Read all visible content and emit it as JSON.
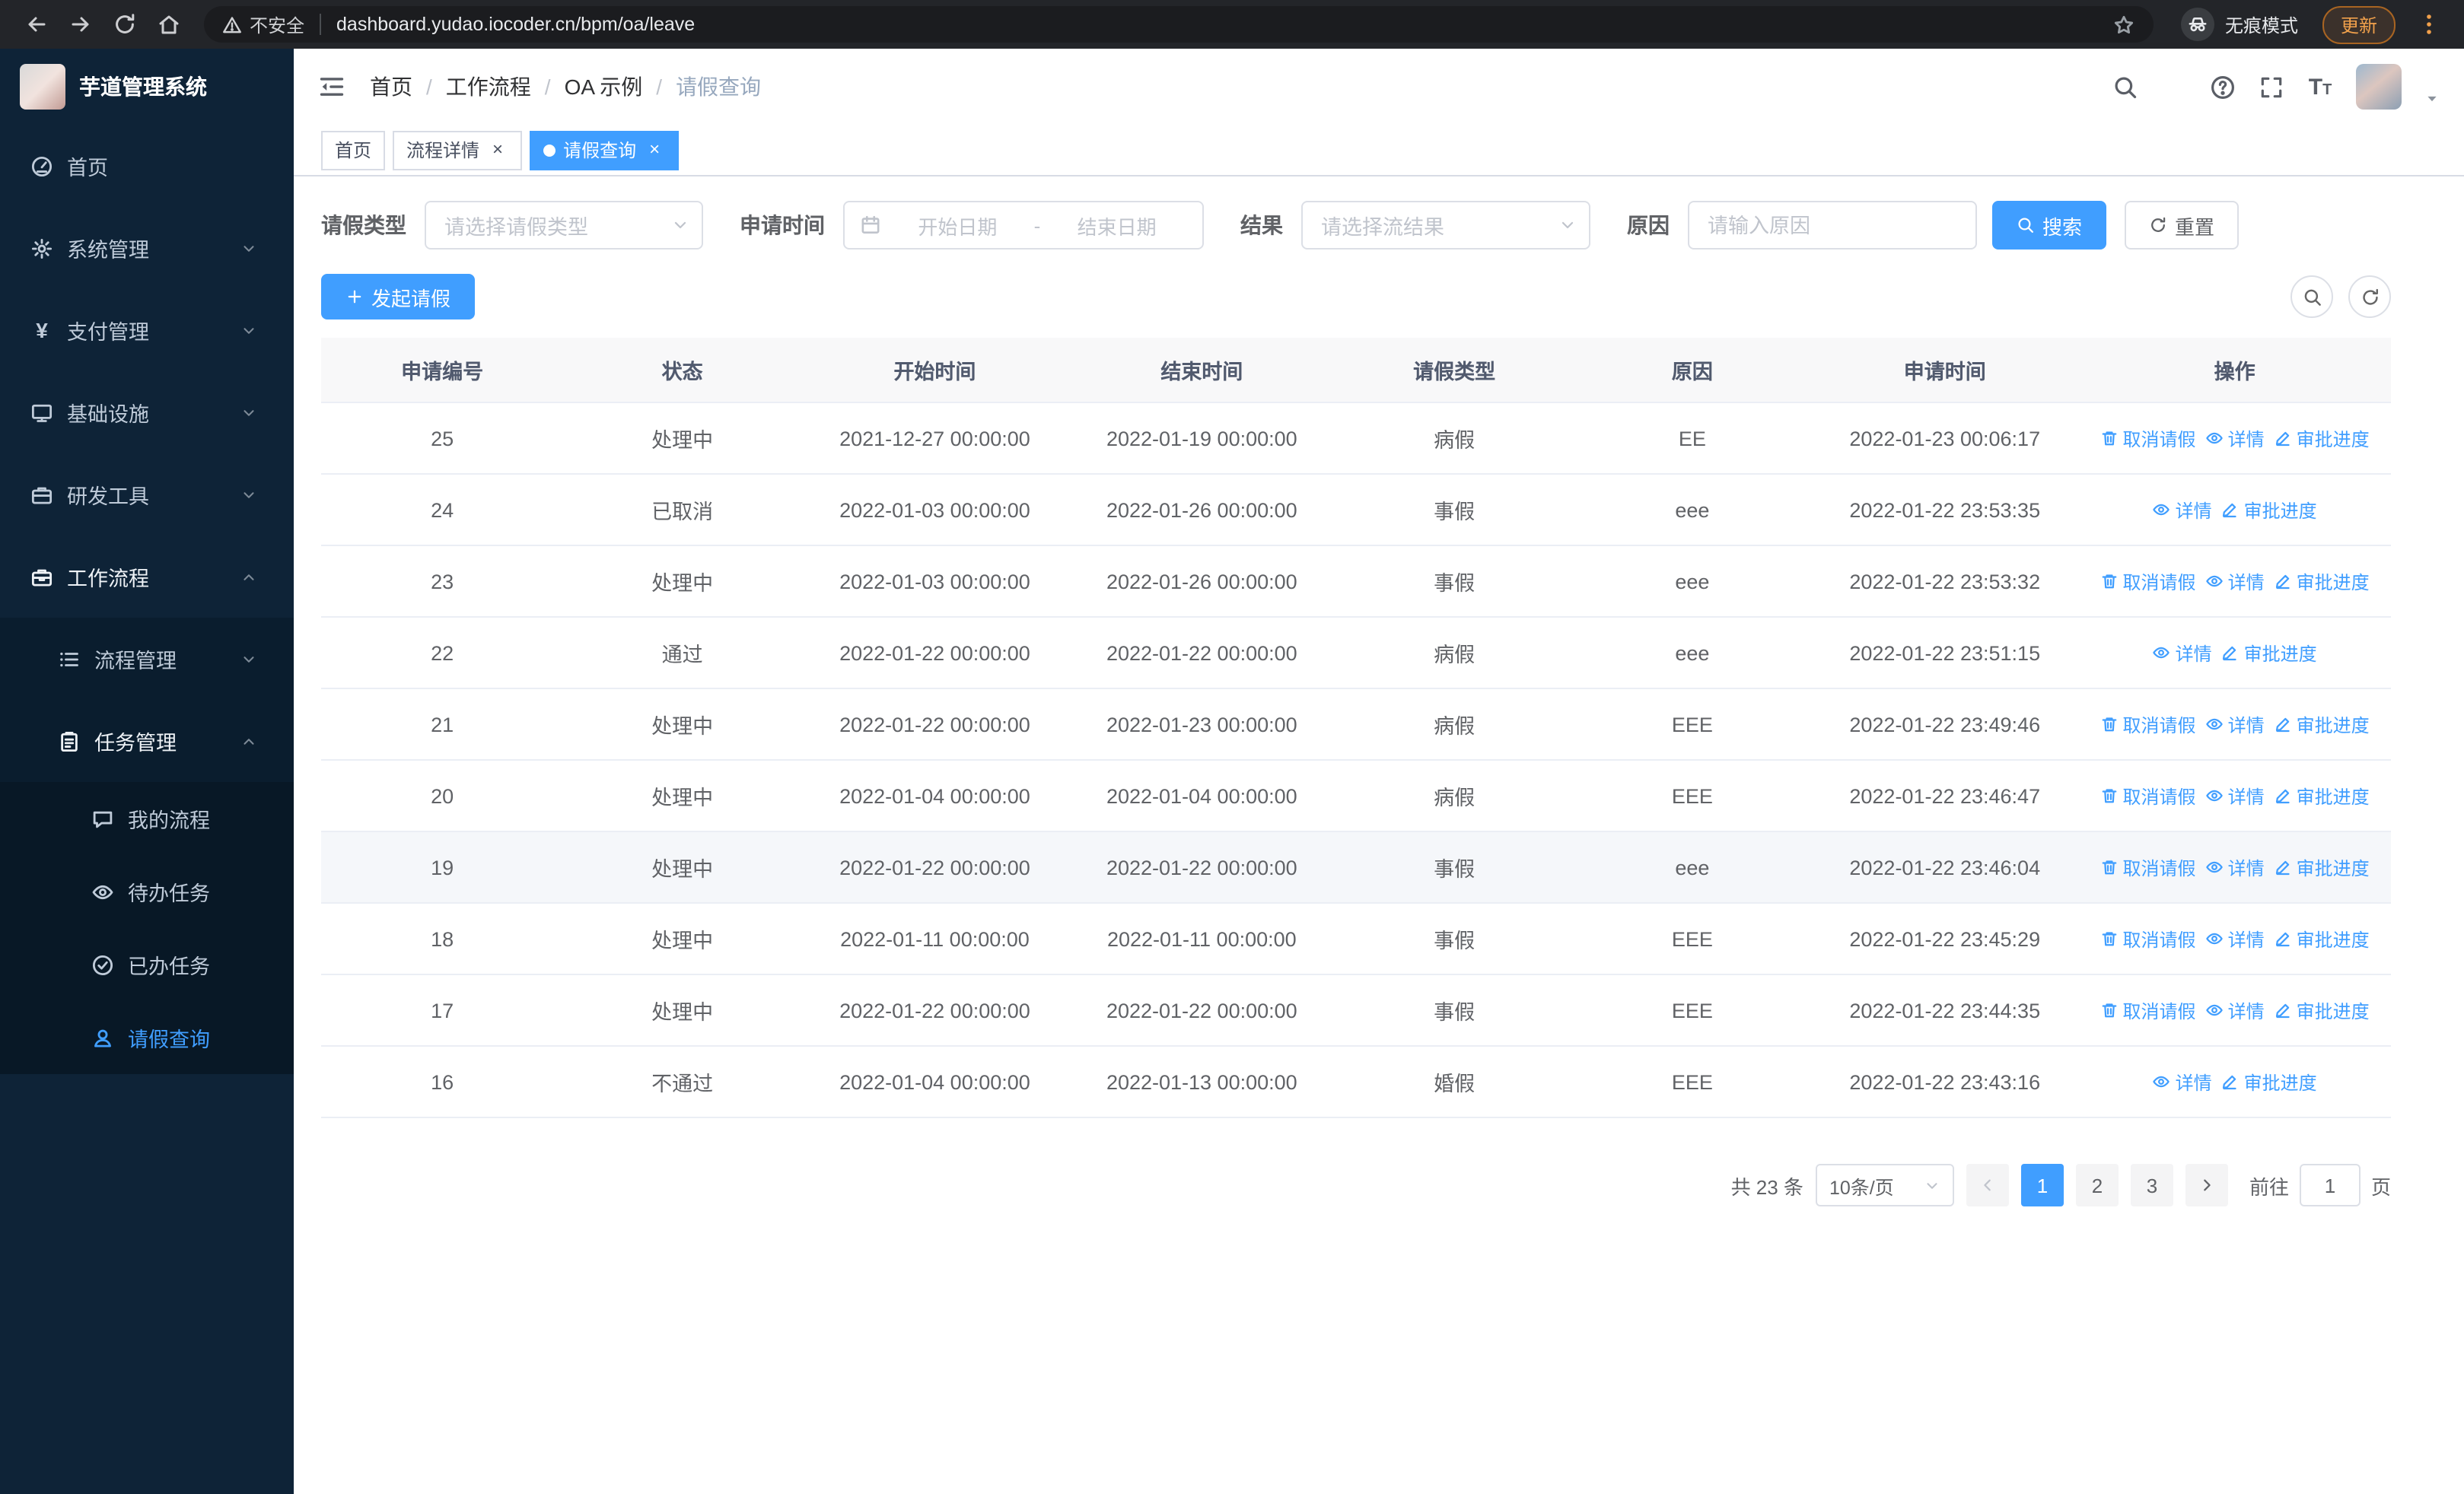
{
  "browser": {
    "nav_icons": [
      "back-arrow-icon",
      "forward-arrow-icon",
      "refresh-icon",
      "home-icon"
    ],
    "security_icon": "warning-icon",
    "security_label": "不安全",
    "url": "dashboard.yudao.iocoder.cn/bpm/oa/leave",
    "bookmark_icon": "star-icon",
    "incognito_icon": "incognito-icon",
    "incognito_label": "无痕模式",
    "update_label": "更新",
    "menu_icon": "dots-vertical-icon"
  },
  "sidebar": {
    "logo_title": "芋道管理系统",
    "items": [
      {
        "key": "home",
        "label": "首页",
        "icon": "dashboard-icon",
        "level": 0
      },
      {
        "key": "system",
        "label": "系统管理",
        "icon": "gear-icon",
        "level": 0,
        "arrow": "down"
      },
      {
        "key": "payment",
        "label": "支付管理",
        "icon": "yen-icon",
        "level": 0,
        "arrow": "down"
      },
      {
        "key": "infrastructure",
        "label": "基础设施",
        "icon": "monitor-icon",
        "level": 0,
        "arrow": "down"
      },
      {
        "key": "devtools",
        "label": "研发工具",
        "icon": "toolbox-icon",
        "level": 0,
        "arrow": "down"
      },
      {
        "key": "workflow",
        "label": "工作流程",
        "icon": "briefcase-icon",
        "level": 0,
        "arrow": "up",
        "open": true
      },
      {
        "key": "process-management",
        "label": "流程管理",
        "icon": "list-icon",
        "level": 1,
        "arrow": "down"
      },
      {
        "key": "task-management",
        "label": "任务管理",
        "icon": "clipboard-icon",
        "level": 1,
        "arrow": "up",
        "open": true
      },
      {
        "key": "my-process",
        "label": "我的流程",
        "icon": "chat-icon",
        "level": 2
      },
      {
        "key": "todo-task",
        "label": "待办任务",
        "icon": "eye-icon",
        "level": 2
      },
      {
        "key": "done-task",
        "label": "已办任务",
        "icon": "check-circle-icon",
        "level": 2
      },
      {
        "key": "leave-query",
        "label": "请假查询",
        "icon": "user-icon",
        "level": 2,
        "active": true
      }
    ]
  },
  "header": {
    "toggle_icon": "fold-icon",
    "breadcrumb": [
      "首页",
      "工作流程",
      "OA 示例",
      "请假查询"
    ],
    "right_icons": [
      "search-icon",
      "github-icon",
      "question-icon",
      "fullscreen-icon",
      "font-size-icon"
    ],
    "avatar_caret_icon": "caret-down-icon"
  },
  "tabs": [
    {
      "key": "home",
      "label": "首页",
      "closable": false,
      "active": false
    },
    {
      "key": "process-detail",
      "label": "流程详情",
      "closable": true,
      "active": false
    },
    {
      "key": "leave-query",
      "label": "请假查询",
      "closable": true,
      "active": true
    }
  ],
  "filters": {
    "leave_type_label": "请假类型",
    "leave_type_placeholder": "请选择请假类型",
    "select_chevron_icon": "chevron-down-icon",
    "apply_time_label": "申请时间",
    "calendar_icon": "calendar-icon",
    "start_date_placeholder": "开始日期",
    "range_separator": "-",
    "end_date_placeholder": "结束日期",
    "result_label": "结果",
    "result_placeholder": "请选择流结果",
    "reason_label": "原因",
    "reason_placeholder": "请输入原因",
    "search_button": {
      "label": "搜索",
      "icon": "search-icon"
    },
    "reset_button": {
      "label": "重置",
      "icon": "refresh-icon"
    }
  },
  "toolbar": {
    "create_button": {
      "label": "发起请假",
      "icon": "plus-icon"
    },
    "tool_icons": [
      "search-icon",
      "refresh-icon"
    ]
  },
  "table": {
    "columns": [
      "申请编号",
      "状态",
      "开始时间",
      "结束时间",
      "请假类型",
      "原因",
      "申请时间",
      "操作"
    ],
    "action_labels": {
      "cancel": "取消请假",
      "detail": "详情",
      "progress": "审批进度"
    },
    "action_icons": {
      "cancel": "delete-icon",
      "detail": "eye-icon",
      "progress": "edit-icon"
    },
    "rows": [
      {
        "id": "25",
        "status": "处理中",
        "start_time": "2021-12-27 00:00:00",
        "end_time": "2022-01-19 00:00:00",
        "leave_type": "病假",
        "reason": "EE",
        "apply_time": "2022-01-23 00:06:17",
        "actions": [
          "cancel",
          "detail",
          "progress"
        ],
        "hover": false
      },
      {
        "id": "24",
        "status": "已取消",
        "start_time": "2022-01-03 00:00:00",
        "end_time": "2022-01-26 00:00:00",
        "leave_type": "事假",
        "reason": "eee",
        "apply_time": "2022-01-22 23:53:35",
        "actions": [
          "detail",
          "progress"
        ],
        "hover": false
      },
      {
        "id": "23",
        "status": "处理中",
        "start_time": "2022-01-03 00:00:00",
        "end_time": "2022-01-26 00:00:00",
        "leave_type": "事假",
        "reason": "eee",
        "apply_time": "2022-01-22 23:53:32",
        "actions": [
          "cancel",
          "detail",
          "progress"
        ],
        "hover": false
      },
      {
        "id": "22",
        "status": "通过",
        "start_time": "2022-01-22 00:00:00",
        "end_time": "2022-01-22 00:00:00",
        "leave_type": "病假",
        "reason": "eee",
        "apply_time": "2022-01-22 23:51:15",
        "actions": [
          "detail",
          "progress"
        ],
        "hover": false
      },
      {
        "id": "21",
        "status": "处理中",
        "start_time": "2022-01-22 00:00:00",
        "end_time": "2022-01-23 00:00:00",
        "leave_type": "病假",
        "reason": "EEE",
        "apply_time": "2022-01-22 23:49:46",
        "actions": [
          "cancel",
          "detail",
          "progress"
        ],
        "hover": false
      },
      {
        "id": "20",
        "status": "处理中",
        "start_time": "2022-01-04 00:00:00",
        "end_time": "2022-01-04 00:00:00",
        "leave_type": "病假",
        "reason": "EEE",
        "apply_time": "2022-01-22 23:46:47",
        "actions": [
          "cancel",
          "detail",
          "progress"
        ],
        "hover": false
      },
      {
        "id": "19",
        "status": "处理中",
        "start_time": "2022-01-22 00:00:00",
        "end_time": "2022-01-22 00:00:00",
        "leave_type": "事假",
        "reason": "eee",
        "apply_time": "2022-01-22 23:46:04",
        "actions": [
          "cancel",
          "detail",
          "progress"
        ],
        "hover": true
      },
      {
        "id": "18",
        "status": "处理中",
        "start_time": "2022-01-11 00:00:00",
        "end_time": "2022-01-11 00:00:00",
        "leave_type": "事假",
        "reason": "EEE",
        "apply_time": "2022-01-22 23:45:29",
        "actions": [
          "cancel",
          "detail",
          "progress"
        ],
        "hover": false
      },
      {
        "id": "17",
        "status": "处理中",
        "start_time": "2022-01-22 00:00:00",
        "end_time": "2022-01-22 00:00:00",
        "leave_type": "事假",
        "reason": "EEE",
        "apply_time": "2022-01-22 23:44:35",
        "actions": [
          "cancel",
          "detail",
          "progress"
        ],
        "hover": false
      },
      {
        "id": "16",
        "status": "不通过",
        "start_time": "2022-01-04 00:00:00",
        "end_time": "2022-01-13 00:00:00",
        "leave_type": "婚假",
        "reason": "EEE",
        "apply_time": "2022-01-22 23:43:16",
        "actions": [
          "detail",
          "progress"
        ],
        "hover": false
      }
    ]
  },
  "pagination": {
    "total_text": "共 23 条",
    "page_size_text": "10条/页",
    "size_chevron_icon": "chevron-down-icon",
    "prev_icon": "arrow-left-icon",
    "next_icon": "arrow-right-icon",
    "pages": [
      "1",
      "2",
      "3"
    ],
    "active_page": "1",
    "goto_label": "前往",
    "goto_value": "1",
    "page_unit": "页"
  }
}
